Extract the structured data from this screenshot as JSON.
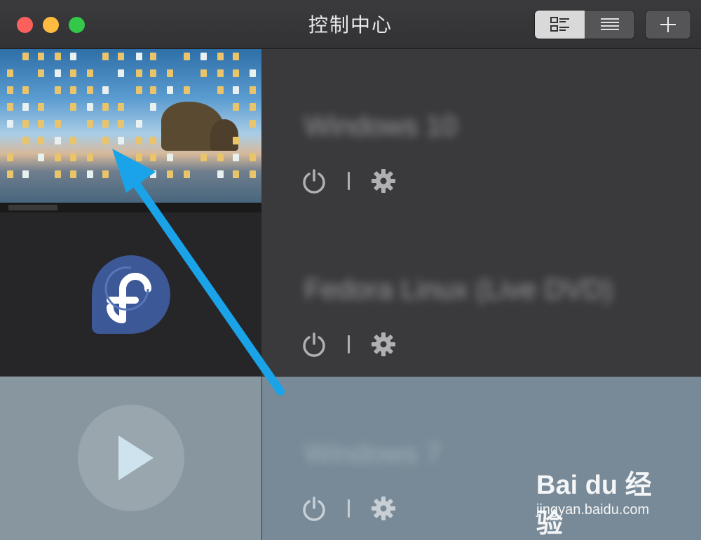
{
  "window": {
    "title": "控制中心",
    "view_toggle": [
      {
        "icon": "detail-list-icon",
        "active": true
      },
      {
        "icon": "compact-list-icon",
        "active": false
      }
    ],
    "add_icon": "plus-icon"
  },
  "vms": [
    {
      "name": "Windows 10",
      "thumbnail": "windows-desktop-screenshot",
      "power_icon": "power-icon",
      "settings_icon": "gear-icon"
    },
    {
      "name": "Fedora Linux (Live DVD)",
      "thumbnail": "fedora-logo",
      "power_icon": "power-icon",
      "settings_icon": "gear-icon"
    },
    {
      "name": "Windows 7",
      "thumbnail": "play-icon",
      "power_icon": "power-icon",
      "settings_icon": "gear-icon",
      "selected": true
    }
  ],
  "watermark": {
    "logo": "Bai du 经验",
    "url": "jingyan.baidu.com"
  },
  "colors": {
    "close": "#fc605c",
    "minimize": "#fdbc40",
    "zoom": "#34c84a",
    "arrow": "#1aa3e8",
    "selected_row": "#788a97"
  }
}
